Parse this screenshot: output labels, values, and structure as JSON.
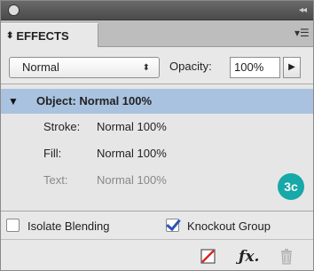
{
  "panel": {
    "tab_label": "EFFECTS"
  },
  "blend": {
    "mode": "Normal",
    "opacity_label": "Opacity:",
    "opacity_value": "100%"
  },
  "list": {
    "object_row": "Object: Normal 100%",
    "attributes": [
      {
        "key": "Stroke:",
        "value": "Normal 100%"
      },
      {
        "key": "Fill:",
        "value": "Normal 100%"
      },
      {
        "key": "Text:",
        "value": "Normal 100%"
      }
    ]
  },
  "badge": {
    "label": "3c",
    "color": "#17a8a8"
  },
  "options": {
    "isolate_label": "Isolate Blending",
    "isolate_checked": false,
    "knockout_label": "Knockout Group",
    "knockout_checked": true
  },
  "toolbar": {
    "icons": [
      "clear-effects-icon",
      "fx-icon",
      "trash-icon"
    ]
  },
  "colors": {
    "selection": "#a9c2e0",
    "checkmark": "#2c55b8"
  }
}
